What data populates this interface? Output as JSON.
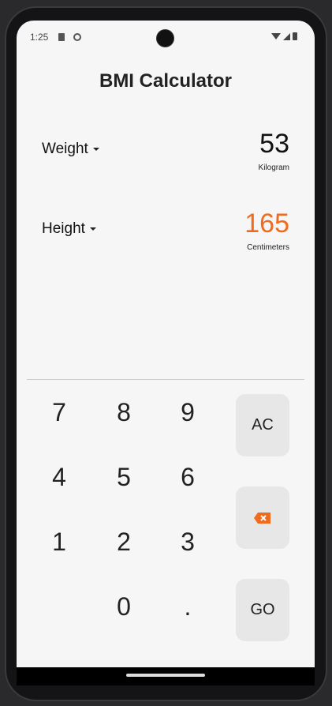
{
  "status": {
    "time": "1:25",
    "icons": [
      "sd-card-icon",
      "notification-icon",
      "wifi-icon",
      "signal-icon",
      "battery-icon"
    ]
  },
  "title": "BMI Calculator",
  "weight": {
    "label": "Weight",
    "value": "53",
    "unit": "Kilogram",
    "color": "#111111"
  },
  "height": {
    "label": "Height",
    "value": "165",
    "unit": "Centimeters",
    "color": "#f26a1b"
  },
  "keypad": {
    "keys": [
      "7",
      "8",
      "9",
      "4",
      "5",
      "6",
      "1",
      "2",
      "3",
      "0",
      "."
    ],
    "clear": "AC",
    "go": "GO",
    "accent": "#f26a1b"
  }
}
